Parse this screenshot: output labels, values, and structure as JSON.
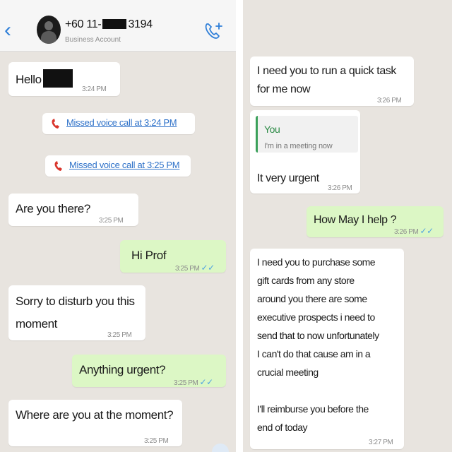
{
  "header": {
    "contact_prefix": "+60 11-",
    "contact_suffix": "3194",
    "contact_sub": "Business Account"
  },
  "left_chat": {
    "hello": {
      "text": "Hello",
      "time": "3:24 PM"
    },
    "missed_1": "Missed voice call at 3:24 PM",
    "missed_2": "Missed voice call at 3:25 PM",
    "are_you_there": {
      "text": "Are you there?",
      "time": "3:25 PM"
    },
    "hi_prof": {
      "text": "Hi Prof",
      "time": "3:25 PM"
    },
    "sorry": {
      "line1": "Sorry to disturb you this",
      "line2": "moment",
      "time": "3:25 PM"
    },
    "anything_urgent": {
      "text": "Anything urgent?",
      "time": "3:25 PM"
    },
    "where": {
      "text": "Where are you at the moment?",
      "time": "3:25 PM"
    }
  },
  "right_chat": {
    "quick_task": {
      "line1": "I need you to run a quick task",
      "line2": "for me now",
      "time": "3:26 PM"
    },
    "urgent": {
      "quote_author": "You",
      "quote_text": "I'm in a meeting now",
      "text": "It very urgent",
      "time": "3:26 PM"
    },
    "how_may": {
      "text": "How May I help ?",
      "time": "3:26 PM"
    },
    "gift_cards": {
      "lines": [
        "I need you to purchase some",
        "gift cards from any store",
        "around you there are some",
        "executive prospects i need to",
        "send that to now unfortunately",
        "I can't do that cause am in a",
        "crucial meeting",
        "",
        "I'll reimburse you before the",
        "end of today"
      ],
      "time": "3:27 PM"
    }
  },
  "colors": {
    "chat_bg": "#e8e4df",
    "incoming": "#ffffff",
    "outgoing": "#dcf7c5",
    "link": "#2f72c9",
    "missed_call_red": "#d9342b",
    "ticks": "#4fa3e0"
  },
  "icons": [
    "chevron-left-icon",
    "avatar",
    "add-call-icon",
    "missed-call-icon",
    "double-check-icon"
  ]
}
